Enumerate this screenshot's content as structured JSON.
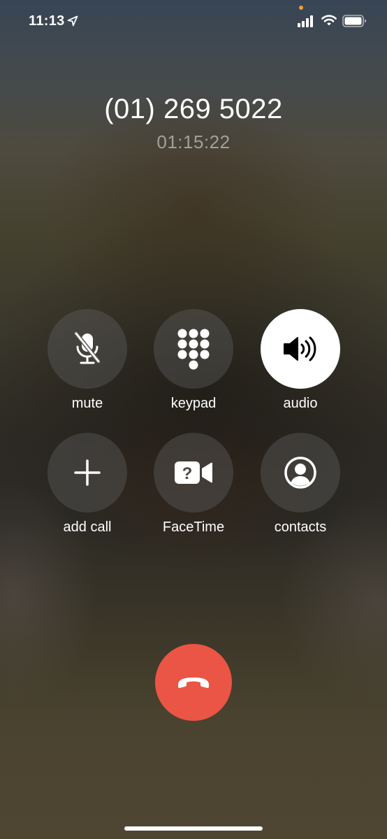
{
  "status_bar": {
    "time": "11:13",
    "icons": [
      "location-arrow-icon",
      "cellular-signal-icon",
      "wifi-icon",
      "battery-icon"
    ],
    "privacy_indicator_color": "#f0a030"
  },
  "call": {
    "number": "(01) 269 5022",
    "duration": "01:15:22"
  },
  "controls": [
    {
      "id": "mute",
      "label": "mute",
      "icon": "microphone-slash-icon",
      "active": false
    },
    {
      "id": "keypad",
      "label": "keypad",
      "icon": "keypad-icon",
      "active": false
    },
    {
      "id": "audio",
      "label": "audio",
      "icon": "speaker-icon",
      "active": true
    },
    {
      "id": "add-call",
      "label": "add call",
      "icon": "plus-icon",
      "active": false
    },
    {
      "id": "facetime",
      "label": "FaceTime",
      "icon": "facetime-video-icon",
      "active": false
    },
    {
      "id": "contacts",
      "label": "contacts",
      "icon": "person-circle-icon",
      "active": false
    }
  ],
  "end_call": {
    "icon": "phone-down-icon",
    "color": "#eb5545"
  },
  "colors": {
    "active_control_bg": "#ffffff",
    "inactive_control_bg": "rgba(100,100,100,0.38)"
  }
}
